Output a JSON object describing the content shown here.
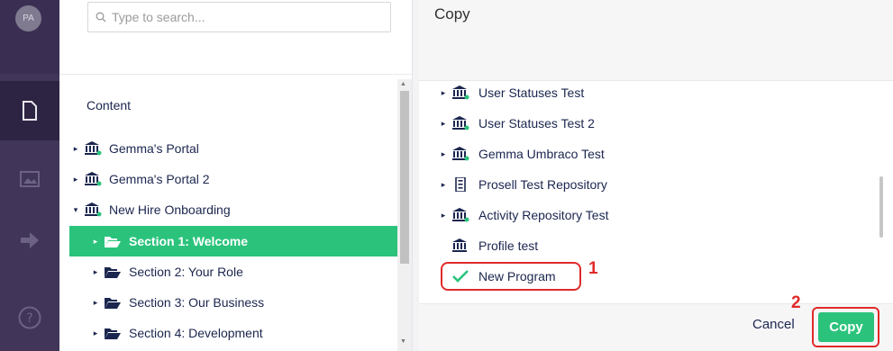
{
  "rail": {
    "avatar_initials": "PA",
    "items": [
      {
        "icon": "document-icon",
        "active": true
      },
      {
        "icon": "image-icon",
        "active": false
      },
      {
        "icon": "arrow-right-icon",
        "active": false
      },
      {
        "icon": "help-icon",
        "active": false
      }
    ]
  },
  "tree": {
    "search_placeholder": "Type to search...",
    "title": "Content",
    "items": [
      {
        "label": "Gemma's Portal",
        "icon": "institution-icon"
      },
      {
        "label": "Gemma's Portal 2",
        "icon": "institution-icon"
      },
      {
        "label": "New Hire Onboarding",
        "icon": "institution-icon",
        "expanded": true
      },
      {
        "label": "Section 1: Welcome",
        "icon": "folder-open-icon",
        "selected": true
      },
      {
        "label": "Section 2: Your Role",
        "icon": "folder-open-icon"
      },
      {
        "label": "Section 3: Our Business",
        "icon": "folder-open-icon"
      },
      {
        "label": "Section 4: Development",
        "icon": "folder-open-icon"
      }
    ]
  },
  "dialog": {
    "title": "Copy",
    "items": [
      {
        "label": "User Statuses Test",
        "icon": "institution-icon"
      },
      {
        "label": "User Statuses Test 2",
        "icon": "institution-icon"
      },
      {
        "label": "Gemma Umbraco Test",
        "icon": "institution-icon"
      },
      {
        "label": "Prosell Test Repository",
        "icon": "repository-icon"
      },
      {
        "label": "Activity Repository Test",
        "icon": "institution-icon"
      },
      {
        "label": "Profile test",
        "icon": "institution-icon"
      },
      {
        "label": "New Program",
        "icon": "checkmark-icon",
        "selected": true
      }
    ],
    "annotation_1": "1",
    "annotation_2": "2",
    "cancel_label": "Cancel",
    "copy_label": "Copy"
  },
  "colors": {
    "accent": "#2bc37c",
    "rail": "#413659",
    "annotation": "#e02a2a"
  }
}
